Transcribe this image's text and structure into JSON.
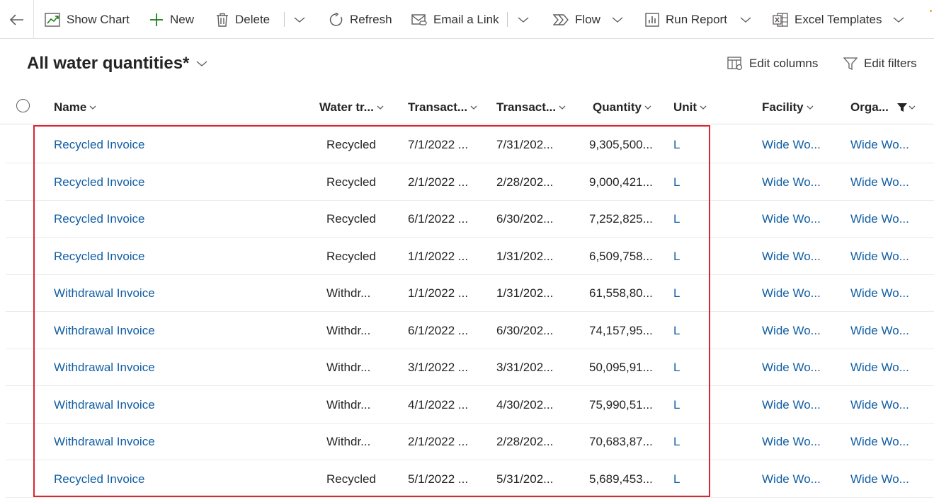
{
  "commandbar": {
    "back_label": "Back",
    "show_chart": "Show Chart",
    "new": "New",
    "delete": "Delete",
    "refresh": "Refresh",
    "email_link": "Email a Link",
    "flow": "Flow",
    "run_report": "Run Report",
    "excel_templates": "Excel Templates"
  },
  "view": {
    "title": "All water quantities*",
    "edit_columns": "Edit columns",
    "edit_filters": "Edit filters"
  },
  "grid": {
    "columns": [
      "Name",
      "Water tr...",
      "Transact...",
      "Transact...",
      "Quantity",
      "Unit",
      "Facility",
      "Orga..."
    ],
    "rows": [
      {
        "name": "Recycled Invoice",
        "type": "Recycled",
        "start": "7/1/2022 ...",
        "end": "7/31/202...",
        "quantity": "9,305,500...",
        "unit": "L",
        "facility": "Wide Wo...",
        "org": "Wide Wo..."
      },
      {
        "name": "Recycled Invoice",
        "type": "Recycled",
        "start": "2/1/2022 ...",
        "end": "2/28/202...",
        "quantity": "9,000,421...",
        "unit": "L",
        "facility": "Wide Wo...",
        "org": "Wide Wo..."
      },
      {
        "name": "Recycled Invoice",
        "type": "Recycled",
        "start": "6/1/2022 ...",
        "end": "6/30/202...",
        "quantity": "7,252,825...",
        "unit": "L",
        "facility": "Wide Wo...",
        "org": "Wide Wo..."
      },
      {
        "name": "Recycled Invoice",
        "type": "Recycled",
        "start": "1/1/2022 ...",
        "end": "1/31/202...",
        "quantity": "6,509,758...",
        "unit": "L",
        "facility": "Wide Wo...",
        "org": "Wide Wo..."
      },
      {
        "name": "Withdrawal Invoice",
        "type": "Withdr...",
        "start": "1/1/2022 ...",
        "end": "1/31/202...",
        "quantity": "61,558,80...",
        "unit": "L",
        "facility": "Wide Wo...",
        "org": "Wide Wo..."
      },
      {
        "name": "Withdrawal Invoice",
        "type": "Withdr...",
        "start": "6/1/2022 ...",
        "end": "6/30/202...",
        "quantity": "74,157,95...",
        "unit": "L",
        "facility": "Wide Wo...",
        "org": "Wide Wo..."
      },
      {
        "name": "Withdrawal Invoice",
        "type": "Withdr...",
        "start": "3/1/2022 ...",
        "end": "3/31/202...",
        "quantity": "50,095,91...",
        "unit": "L",
        "facility": "Wide Wo...",
        "org": "Wide Wo..."
      },
      {
        "name": "Withdrawal Invoice",
        "type": "Withdr...",
        "start": "4/1/2022 ...",
        "end": "4/30/202...",
        "quantity": "75,990,51...",
        "unit": "L",
        "facility": "Wide Wo...",
        "org": "Wide Wo..."
      },
      {
        "name": "Withdrawal Invoice",
        "type": "Withdr...",
        "start": "2/1/2022 ...",
        "end": "2/28/202...",
        "quantity": "70,683,87...",
        "unit": "L",
        "facility": "Wide Wo...",
        "org": "Wide Wo..."
      },
      {
        "name": "Recycled Invoice",
        "type": "Recycled",
        "start": "5/1/2022 ...",
        "end": "5/31/202...",
        "quantity": "5,689,453...",
        "unit": "L",
        "facility": "Wide Wo...",
        "org": "Wide Wo..."
      }
    ]
  },
  "colors": {
    "link": "#115ea3",
    "highlight": "#d9262f",
    "new_icon": "#107c10"
  }
}
